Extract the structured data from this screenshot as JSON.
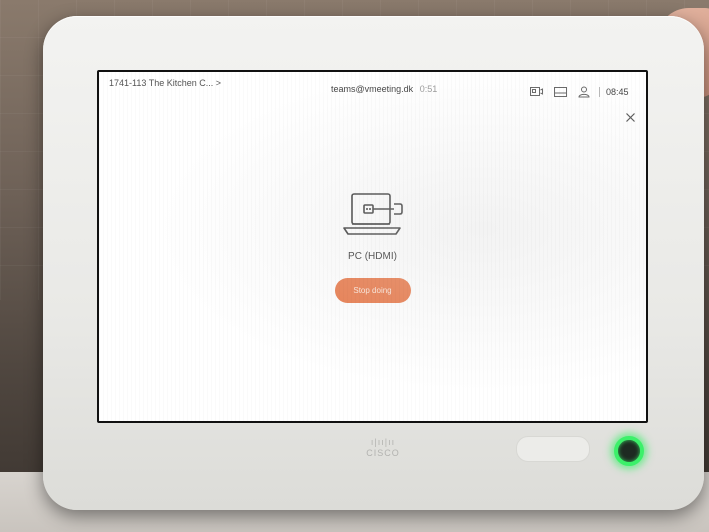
{
  "status_bar": {
    "room_name": "1741-113 The Kitchen C... >",
    "call_address": "teams@vmeeting.dk",
    "call_timer": "0:51",
    "clock": "08:45",
    "icons": [
      "share-screen-icon",
      "layout-icon",
      "participants-icon"
    ]
  },
  "main": {
    "source_icon": "laptop-hdmi-icon",
    "source_name": "PC (HDMI)",
    "stop_button_label": "Stop doing"
  },
  "device": {
    "logo_text": "CISCO",
    "led_color": "#3cf06a"
  },
  "colors": {
    "accent": "#e8794a",
    "screen_bg": "#ffffff"
  }
}
